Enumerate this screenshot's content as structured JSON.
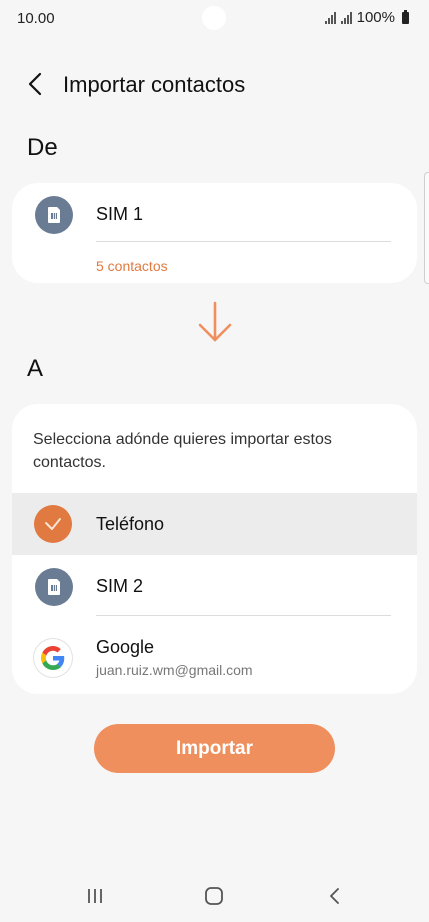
{
  "status_bar": {
    "time": "10.00",
    "battery": "100%",
    "icons": [
      "signal-icon",
      "signal-icon",
      "battery-icon"
    ]
  },
  "header": {
    "title": "Importar contactos",
    "back_icon": "chevron-left-icon"
  },
  "from_section": {
    "label": "De",
    "source": {
      "icon": "sim-card-icon",
      "title": "SIM 1",
      "count": "5 contactos"
    }
  },
  "direction_icon": "arrow-down-icon",
  "to_section": {
    "label": "A",
    "instruction": "Selecciona adónde quieres importar estos contactos.",
    "options": [
      {
        "icon": "check-icon",
        "title": "Teléfono",
        "selected": true
      },
      {
        "icon": "sim-card-icon",
        "title": "SIM 2",
        "selected": false
      },
      {
        "icon": "google-icon",
        "title": "Google",
        "subtitle": "juan.ruiz.wm@gmail.com",
        "selected": false
      }
    ]
  },
  "import_button": {
    "label": "Importar"
  },
  "nav_bar": {
    "recents_icon": "recents-icon",
    "home_icon": "home-icon",
    "back_icon": "back-icon"
  },
  "colors": {
    "accent": "#e07a40",
    "button": "#ef8f5e",
    "sim_icon_bg": "#6a7c94",
    "background": "#f6f6f6",
    "selected_row": "#ececec"
  }
}
